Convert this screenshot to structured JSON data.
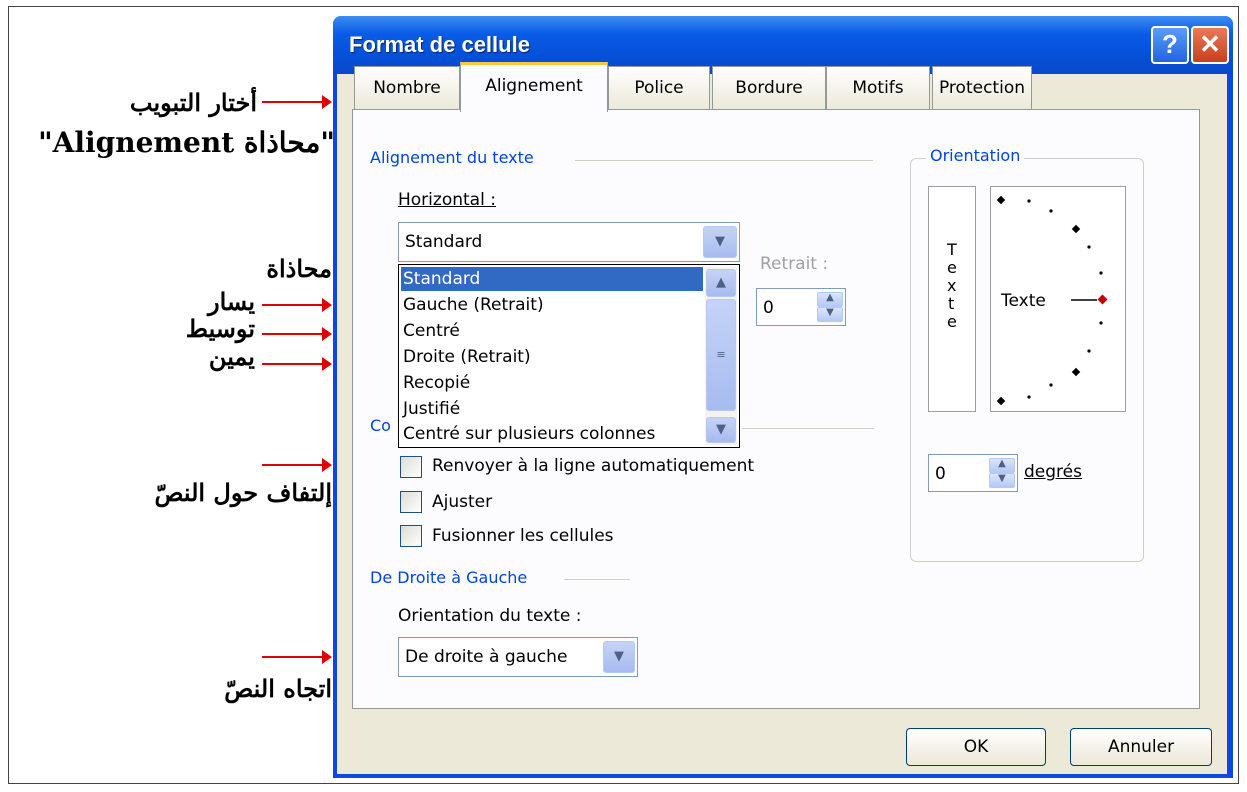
{
  "annotations": {
    "select_tab": "أختار التبويب",
    "alignment_tab_name": "\"محاذاة Alignement\"",
    "alignment": "محاذاة",
    "left": "يسار",
    "center": "توسيط",
    "right": "يمين",
    "wrap_text": "إلتفاف حول النصّ",
    "text_direction": "اتجاه النصّ"
  },
  "dialog": {
    "title": "Format de cellule",
    "help_glyph": "?",
    "close_glyph": "✕"
  },
  "tabs": [
    {
      "label": "Nombre",
      "selected": false
    },
    {
      "label": "Alignement",
      "selected": true
    },
    {
      "label": "Police",
      "selected": false
    },
    {
      "label": "Bordure",
      "selected": false
    },
    {
      "label": "Motifs",
      "selected": false
    },
    {
      "label": "Protection",
      "selected": false
    }
  ],
  "text_alignment": {
    "group_label": "Alignement du texte",
    "horizontal_label": "Horizontal :",
    "horizontal_value": "Standard",
    "indent_label": "Retrait :",
    "indent_value": "0",
    "options": [
      "Standard",
      "Gauche (Retrait)",
      "Centré",
      "Droite (Retrait)",
      "Recopié",
      "Justifié",
      "Centré sur plusieurs colonnes"
    ],
    "selected_option": "Standard"
  },
  "text_control": {
    "group_label_visible": "Co",
    "wrap_label": "Renvoyer à la ligne automatiquement",
    "wrap_checked": false,
    "shrink_label": "Ajuster",
    "shrink_checked": false,
    "merge_label": "Fusionner les cellules",
    "merge_checked": false
  },
  "rtl": {
    "group_label": "De Droite à Gauche",
    "direction_label": "Orientation du texte :",
    "direction_value": "De droite à gauche"
  },
  "orientation": {
    "group_label": "Orientation",
    "vertical_text_letters": [
      "T",
      "e",
      "x",
      "t",
      "e"
    ],
    "dial_text": "Texte",
    "degrees_value": "0",
    "degrees_label": "degrés",
    "accent_color": "#c00000"
  },
  "buttons": {
    "ok": "OK",
    "cancel": "Annuler"
  },
  "colors": {
    "title_bar": "#0a5ae6",
    "group_label": "#0046d5",
    "selection": "#316ac5",
    "arrow": "#e00000",
    "tab_highlight": "#ffc83c"
  }
}
